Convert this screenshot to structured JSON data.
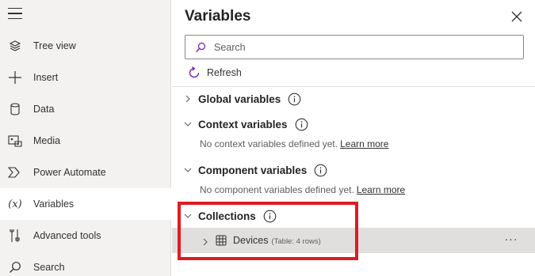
{
  "nav": {
    "items": [
      {
        "label": "Tree view",
        "icon": "layers-icon"
      },
      {
        "label": "Insert",
        "icon": "plus-icon"
      },
      {
        "label": "Data",
        "icon": "database-icon"
      },
      {
        "label": "Media",
        "icon": "media-icon"
      },
      {
        "label": "Power Automate",
        "icon": "power-automate-icon"
      },
      {
        "label": "Variables",
        "icon": "variables-icon",
        "selected": true
      },
      {
        "label": "Advanced tools",
        "icon": "tools-icon"
      },
      {
        "label": "Search",
        "icon": "search-icon"
      }
    ]
  },
  "panel": {
    "title": "Variables",
    "search_placeholder": "Search",
    "refresh_label": "Refresh",
    "sections": [
      {
        "title": "Global variables",
        "expanded": false
      },
      {
        "title": "Context variables",
        "expanded": true,
        "empty_text": "No context variables defined yet.",
        "link": "Learn more"
      },
      {
        "title": "Component variables",
        "expanded": true,
        "empty_text": "No component variables defined yet.",
        "link": "Learn more"
      },
      {
        "title": "Collections",
        "expanded": true
      }
    ],
    "collection_item": {
      "name": "Devices",
      "meta": "(Table: 4 rows)",
      "more": "···"
    }
  },
  "colors": {
    "highlight": "#e01b22",
    "selected_row": "#e1dfdd",
    "nav_bg": "#f3f2f1"
  }
}
